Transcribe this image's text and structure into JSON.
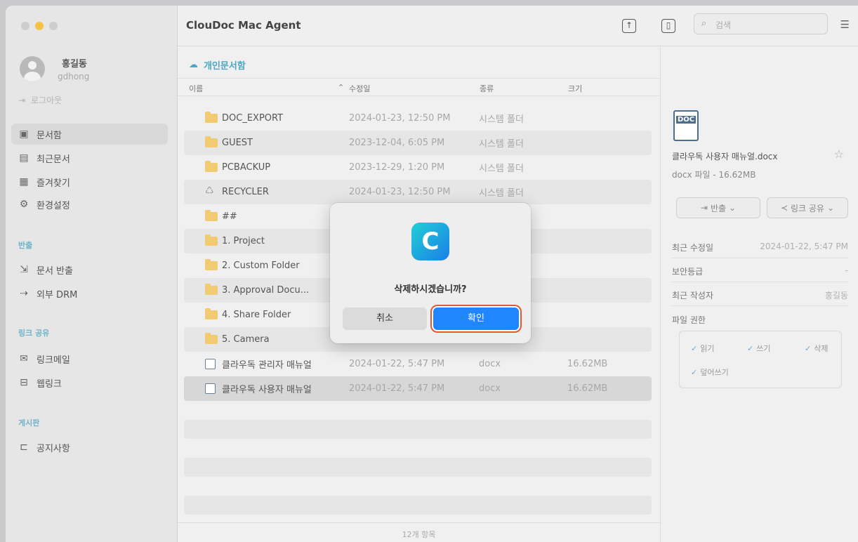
{
  "window": {
    "title": "ClouDoc Mac Agent"
  },
  "user": {
    "name": "홍길동",
    "id": "gdhong",
    "logout": "로그아웃"
  },
  "sidebar": {
    "main_items": [
      {
        "label": "문서함",
        "icon": "folder-box-icon"
      },
      {
        "label": "최근문서",
        "icon": "recent-doc-icon"
      },
      {
        "label": "즐겨찾기",
        "icon": "favorite-doc-icon"
      },
      {
        "label": "환경설정",
        "icon": "gear-icon"
      }
    ],
    "export_section": {
      "title": "반출",
      "items": [
        {
          "label": "문서 반출"
        },
        {
          "label": "외부 DRM"
        }
      ]
    },
    "link_section": {
      "title": "링크 공유",
      "items": [
        {
          "label": "링크메일"
        },
        {
          "label": "웹링크"
        }
      ]
    },
    "board_section": {
      "title": "게시판",
      "items": [
        {
          "label": "공지사항"
        }
      ]
    }
  },
  "header": {
    "search_placeholder": "검색"
  },
  "breadcrumb": {
    "label": "개인문서함"
  },
  "columns": {
    "name": "이름",
    "modified": "수정일",
    "type": "종류",
    "size": "크기"
  },
  "files": [
    {
      "name": "DOC_EXPORT",
      "date": "2024-01-23, 12:50 PM",
      "type": "시스템 폴더",
      "size": "",
      "kind": "export-folder"
    },
    {
      "name": "GUEST",
      "date": "2023-12-04, 6:05 PM",
      "type": "시스템 폴더",
      "size": "",
      "kind": "folder"
    },
    {
      "name": "PCBACKUP",
      "date": "2023-12-29, 1:20 PM",
      "type": "시스템 폴더",
      "size": "",
      "kind": "folder"
    },
    {
      "name": "RECYCLER",
      "date": "2024-01-23, 12:50 PM",
      "type": "시스템 폴더",
      "size": "",
      "kind": "recycle"
    },
    {
      "name": "##",
      "date": "",
      "type": "",
      "size": "",
      "kind": "folder"
    },
    {
      "name": "1. Project",
      "date": "",
      "type": "",
      "size": "",
      "kind": "folder"
    },
    {
      "name": "2. Custom Folder",
      "date": "",
      "type": "",
      "size": "",
      "kind": "folder"
    },
    {
      "name": "3. Approval Docu...",
      "date": "",
      "type": "",
      "size": "",
      "kind": "folder"
    },
    {
      "name": "4. Share Folder",
      "date": "",
      "type": "",
      "size": "",
      "kind": "folder"
    },
    {
      "name": "5. Camera",
      "date": "",
      "type": "",
      "size": "",
      "kind": "folder"
    },
    {
      "name": "클라우독 관리자 매뉴얼",
      "date": "2024-01-22, 5:47 PM",
      "type": "docx",
      "size": "16.62MB",
      "kind": "doc"
    },
    {
      "name": "클라우독 사용자 매뉴얼",
      "date": "2024-01-22, 5:47 PM",
      "type": "docx",
      "size": "16.62MB",
      "kind": "doc"
    }
  ],
  "footer": {
    "count": "12개 항목"
  },
  "detail": {
    "icon_label": "DOC",
    "file_name": "클라우독 사용자 매뉴얼.docx",
    "meta": "docx 파일 - 16.62MB",
    "export_btn": "반출",
    "share_btn": "링크 공유",
    "props": [
      {
        "k": "최근 수정일",
        "v": "2024-01-22, 5:47 PM"
      },
      {
        "k": "보안등급",
        "v": "-"
      },
      {
        "k": "최근 작성자",
        "v": "홍길동"
      }
    ],
    "perm_title": "파일 권한",
    "perms": [
      "읽기",
      "쓰기",
      "삭제",
      "덮어쓰기"
    ]
  },
  "dialog": {
    "logo_letter": "C",
    "message": "삭제하시겠습니까?",
    "cancel": "취소",
    "confirm": "확인"
  },
  "colors": {
    "accent": "#1f86ff",
    "highlight": "#e8562f",
    "folder": "#f0cb72"
  }
}
